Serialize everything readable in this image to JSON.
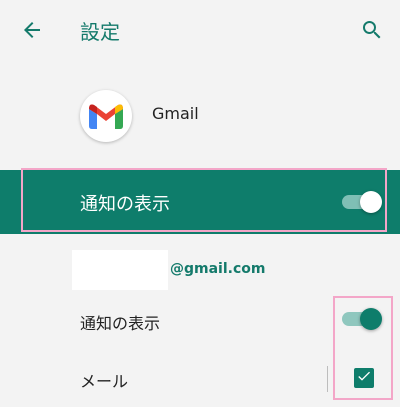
{
  "header": {
    "title": "設定",
    "back_icon": "arrow-left-icon",
    "search_icon": "search-icon"
  },
  "app": {
    "name": "Gmail",
    "icon": "gmail-logo-icon"
  },
  "master_toggle": {
    "label": "通知の表示",
    "state": "on"
  },
  "account": {
    "domain": "@gmail.com"
  },
  "settings": [
    {
      "label": "通知の表示",
      "control": "switch",
      "state": "on"
    },
    {
      "label": "メール",
      "control": "checkbox",
      "state": "checked"
    }
  ],
  "colors": {
    "accent": "#0e7d6b",
    "title_text": "#147a6b",
    "highlight_outline": "#f3a6c8",
    "background": "#f3f3f3"
  }
}
